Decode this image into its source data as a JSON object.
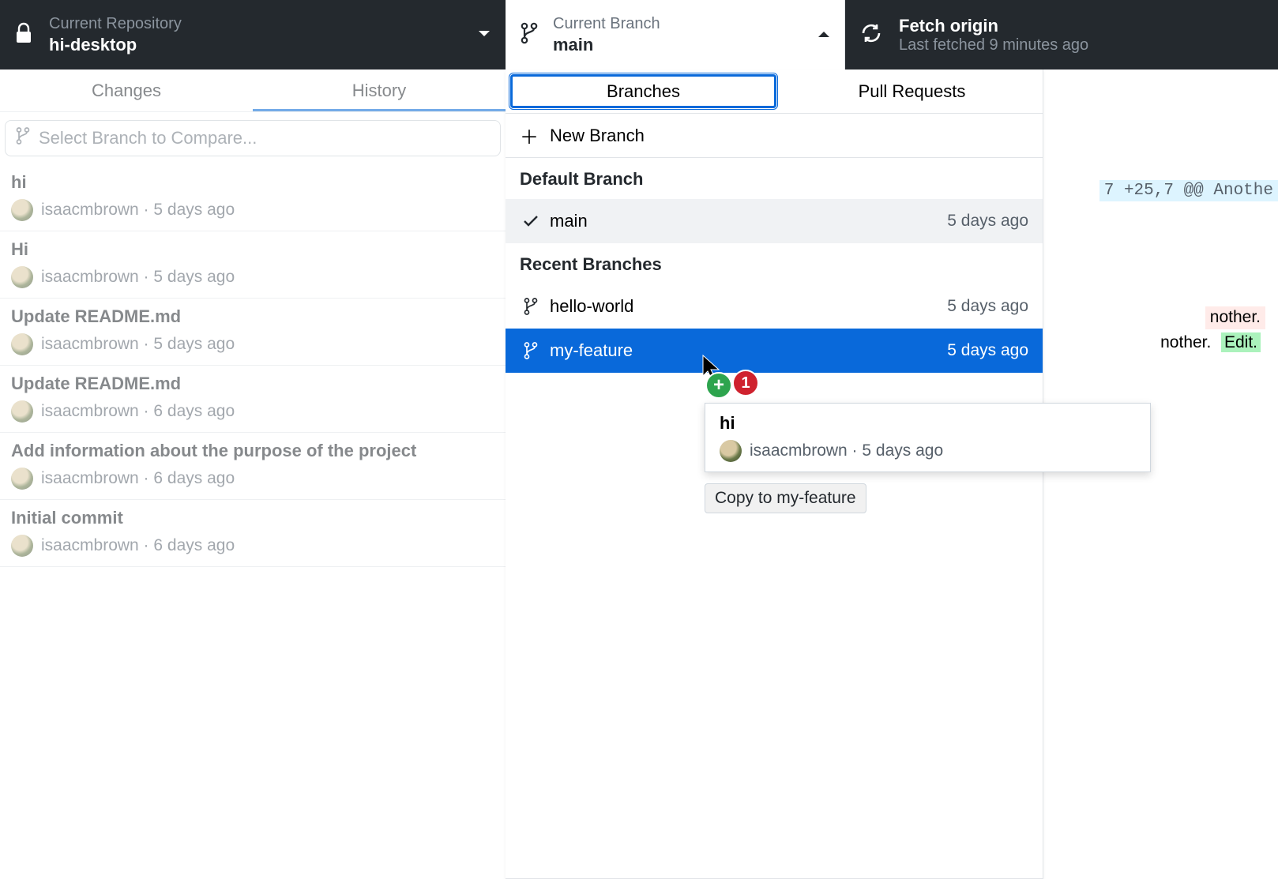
{
  "titlebar": {
    "repo_label": "Current Repository",
    "repo_name": "hi-desktop",
    "branch_label": "Current Branch",
    "branch_name": "main",
    "fetch_title": "Fetch origin",
    "fetch_sub": "Last fetched 9 minutes ago"
  },
  "left_tabs": {
    "changes": "Changes",
    "history": "History"
  },
  "compare_placeholder": "Select Branch to Compare...",
  "commits": [
    {
      "title": "hi",
      "author": "isaacmbrown",
      "time": "5 days ago"
    },
    {
      "title": "Hi",
      "author": "isaacmbrown",
      "time": "5 days ago"
    },
    {
      "title": "Update README.md",
      "author": "isaacmbrown",
      "time": "5 days ago"
    },
    {
      "title": "Update README.md",
      "author": "isaacmbrown",
      "time": "6 days ago"
    },
    {
      "title": "Add information about the purpose of the project",
      "author": "isaacmbrown",
      "time": "6 days ago"
    },
    {
      "title": "Initial commit",
      "author": "isaacmbrown",
      "time": "6 days ago"
    }
  ],
  "branch_dropdown": {
    "tab_branches": "Branches",
    "tab_pull": "Pull Requests",
    "new_branch": "New Branch",
    "default_heading": "Default Branch",
    "recent_heading": "Recent Branches",
    "default_item": {
      "name": "main",
      "time": "5 days ago"
    },
    "recent": [
      {
        "name": "hello-world",
        "time": "5 days ago"
      },
      {
        "name": "my-feature",
        "time": "5 days ago"
      }
    ]
  },
  "drag": {
    "title": "hi",
    "author": "isaacmbrown",
    "time": "5 days ago",
    "copy_label": "Copy to my-feature",
    "count": "1"
  },
  "diff": {
    "hunk": "7 +25,7 @@ Anothe",
    "ctx1": "nother.",
    "ctx2": "nother.",
    "edit": "Edit."
  }
}
